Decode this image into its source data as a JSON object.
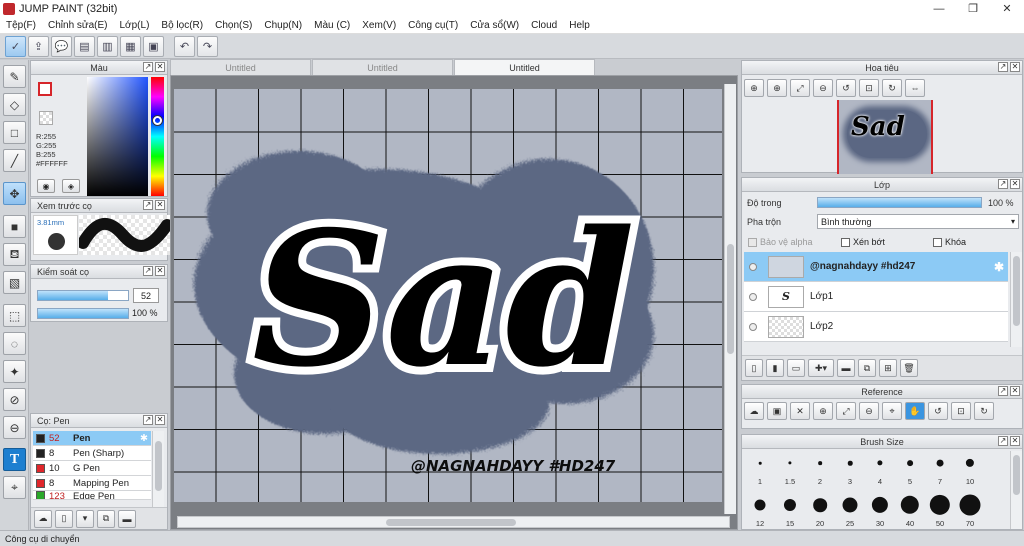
{
  "window": {
    "title": "JUMP PAINT (32bit)",
    "minimize": "—",
    "restore": "❐",
    "close": "✕"
  },
  "menu": [
    "Tệp(F)",
    "Chỉnh sửa(E)",
    "Lớp(L)",
    "Bộ lọc(R)",
    "Chọn(S)",
    "Chụp(N)",
    "Màu (C)",
    "Xem(V)",
    "Công cụ(T)",
    "Cửa sổ(W)",
    "Cloud",
    "Help"
  ],
  "toolbar": {
    "icons": [
      "brush-settings-icon",
      "export-icon",
      "comment-icon",
      "message-icon",
      "page-icon",
      "document-icon",
      "grid-settings-icon",
      "undo-icon",
      "redo-icon"
    ],
    "glyphs": [
      "✓",
      "⇪",
      "💬",
      "▤",
      "▥",
      "▦",
      "▣",
      "↶",
      "↷"
    ]
  },
  "color_panel": {
    "title": "Màu",
    "r": "R:255",
    "g": "G:255",
    "b": "B:255",
    "hex": "#FFFFFF",
    "main_color": "#FFFFFF",
    "accent": "#D6252A"
  },
  "brush_preview": {
    "title": "Xem trước cọ",
    "size": "3.81mm"
  },
  "brush_control": {
    "title": "Kiểm soát cọ",
    "size_value": "52",
    "size_fraction": 0.78,
    "opacity_value": "100 %",
    "opacity_fraction": 1.0
  },
  "brush_list": {
    "title": "Cọ: Pen",
    "items": [
      {
        "size": "52",
        "name": "Pen",
        "color": "#222222",
        "selected": true
      },
      {
        "size": "8",
        "name": "Pen (Sharp)",
        "color": "#222222",
        "selected": false
      },
      {
        "size": "10",
        "name": "G Pen",
        "color": "#e0262b",
        "selected": false
      },
      {
        "size": "8",
        "name": "Mapping Pen",
        "color": "#e0262b",
        "selected": false
      },
      {
        "size": "123",
        "name": "Edge Pen",
        "color": "#2aa82a",
        "selected": false
      }
    ]
  },
  "tabs": [
    {
      "label": "Untitled",
      "active": false
    },
    {
      "label": "Untitled",
      "active": false
    },
    {
      "label": "Untitled",
      "active": true
    }
  ],
  "canvas": {
    "word": "Sad",
    "watermark": "@NAGNAHDAYY #HD247",
    "glow_color": "#5B6783",
    "bg_color": "#B1B7C4"
  },
  "navigator": {
    "title": "Hoa tiêu",
    "preview_word": "Sad"
  },
  "layer_panel": {
    "title": "Lớp",
    "opacity_label": "Độ trong",
    "opacity_value": "100 %",
    "opacity_fraction": 1.0,
    "blend_label": "Pha trộn",
    "blend_value": "Bình thường",
    "protect_alpha": "Bảo vệ alpha",
    "clipping": "Xén bớt",
    "lock": "Khóa",
    "layers": [
      {
        "name": "@nagnahdayy #hd247",
        "selected": true
      },
      {
        "name": "Lớp1",
        "selected": false
      },
      {
        "name": "Lớp2",
        "selected": false
      }
    ]
  },
  "reference": {
    "title": "Reference"
  },
  "brush_size": {
    "title": "Brush Size",
    "sizes": [
      "1",
      "1.5",
      "2",
      "3",
      "4",
      "5",
      "7",
      "10",
      "12",
      "15",
      "20",
      "25",
      "30",
      "40",
      "50",
      "70"
    ]
  },
  "status": {
    "text": "Công cụ di chuyển"
  }
}
